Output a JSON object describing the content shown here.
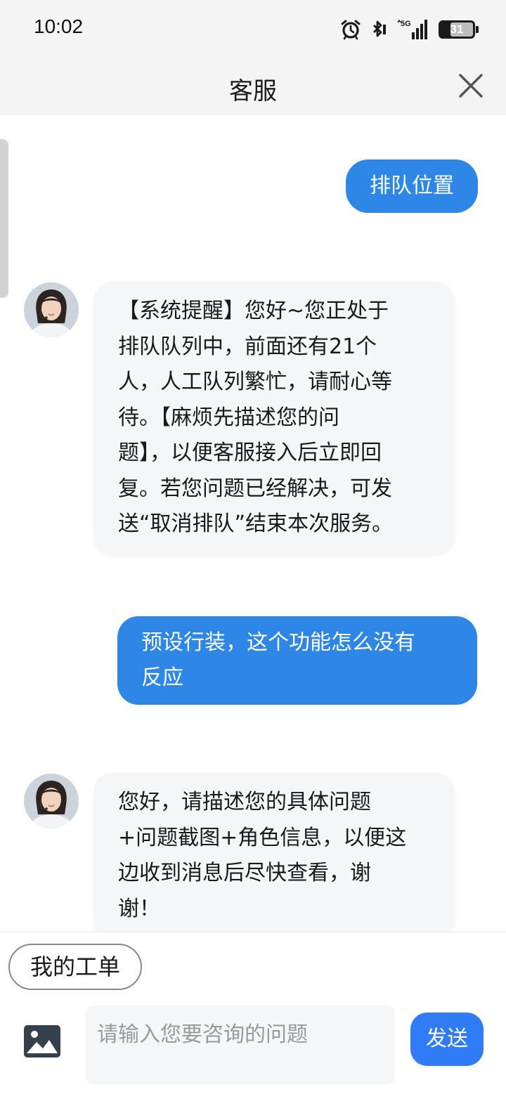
{
  "status_bar": {
    "time": "10:02",
    "network": "5G",
    "battery": "31",
    "icons": [
      "alarm-icon",
      "bluetooth-icon",
      "signal-5g-icon",
      "battery-icon"
    ]
  },
  "header": {
    "title": "客服",
    "close_icon": "close-icon"
  },
  "messages": [
    {
      "sender": "user",
      "text": "排队位置"
    },
    {
      "sender": "agent",
      "lines": [
        "【系统提醒】您好~您正处于",
        "排队队列中，前面还有21个",
        "人，人工队列繁忙，请耐心等",
        "待。【麻烦先描述您的问",
        "题】，以便客服接入后立即回",
        "复。若您问题已经解决，可发",
        "送“取消排队”结束本次服务。"
      ]
    },
    {
      "sender": "user",
      "lines": [
        "预设行装，这个功能怎么没有",
        "反应"
      ]
    },
    {
      "sender": "agent",
      "lines": [
        "您好，请描述您的具体问题",
        "+问题截图+角色信息，以便这",
        "边收到消息后尽快查看，谢",
        "谢！"
      ]
    }
  ],
  "bottom_bar": {
    "ticket_button": "我的工单",
    "image_icon": "image-icon",
    "input_placeholder": "请输入您要咨询的问题",
    "send_button": "发送"
  },
  "colors": {
    "user_bubble": "#2e87e6",
    "agent_bubble": "#f5f6f8",
    "send_button": "#2f7cf6",
    "header_bg": "#f4f4f4"
  }
}
